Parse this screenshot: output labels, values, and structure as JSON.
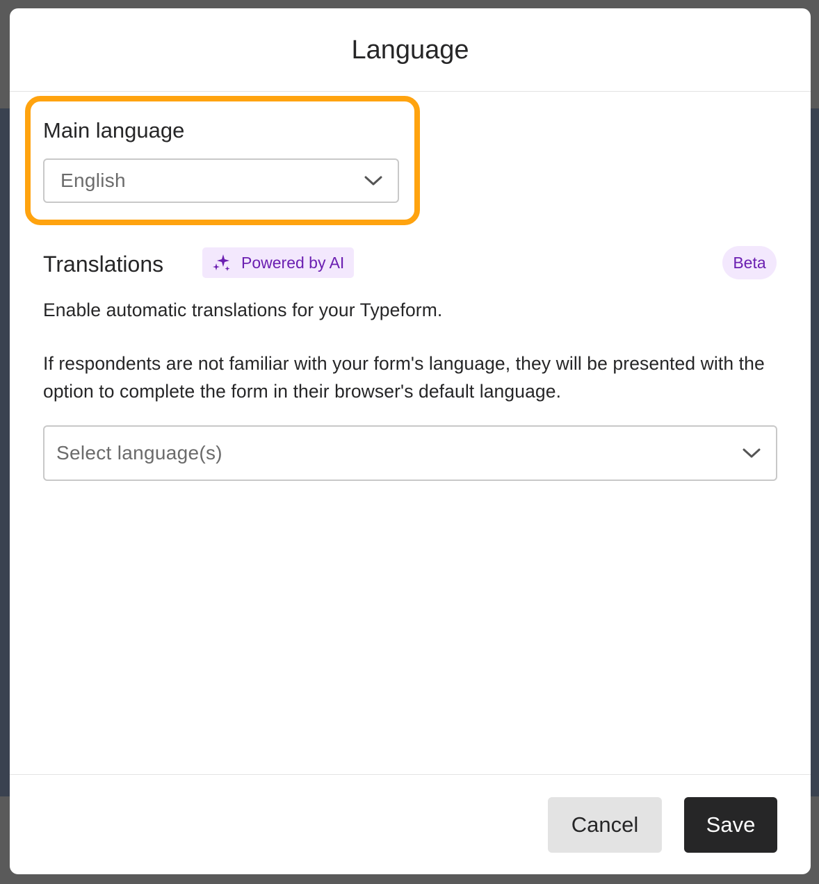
{
  "modal": {
    "title": "Language"
  },
  "main_language": {
    "label": "Main language",
    "selected": "English"
  },
  "translations": {
    "title": "Translations",
    "ai_badge": "Powered by AI",
    "beta_badge": "Beta",
    "description_1": "Enable automatic translations for your Typeform.",
    "description_2": "If respondents are not familiar with your form's language, they will be presented with the option to complete the form in their browser's default language.",
    "select_placeholder": "Select language(s)"
  },
  "footer": {
    "cancel_label": "Cancel",
    "save_label": "Save"
  },
  "colors": {
    "highlight": "#ffa30f",
    "ai_purple": "#6b1fb1",
    "badge_bg": "#f3e8fd",
    "primary_button": "#262627"
  },
  "icons": {
    "dropdown": "chevron-down-icon",
    "ai": "sparkle-icon"
  }
}
